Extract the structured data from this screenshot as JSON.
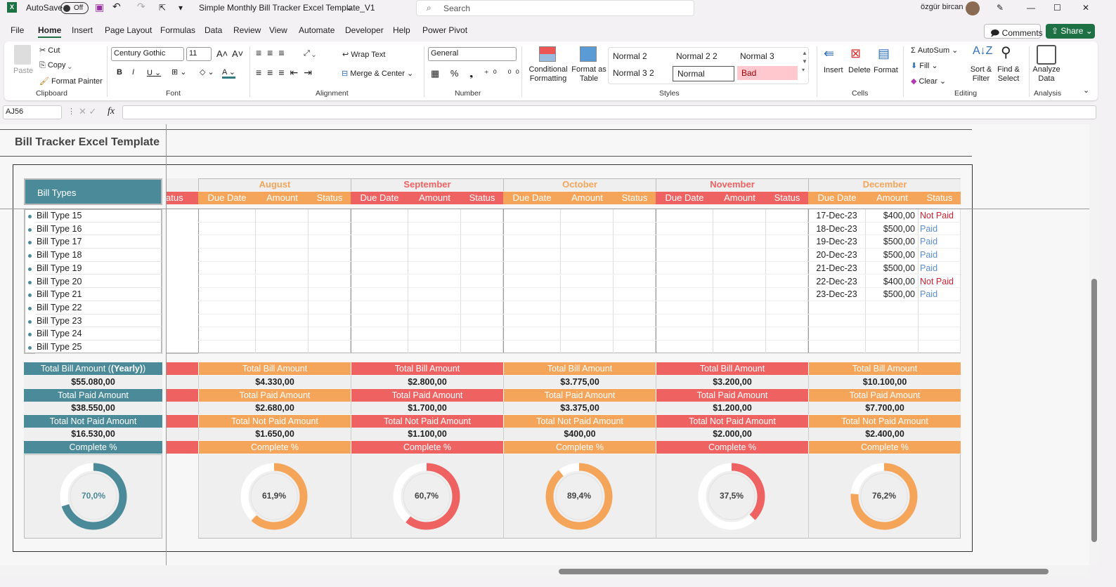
{
  "titlebar": {
    "app_icon": "excel-icon",
    "autosave_label": "AutoSave",
    "autosave_state": "Off",
    "filename": "Simple Monthly Bill Tracker Excel Template_V1",
    "search_placeholder": "Search",
    "user": "özgür bircan"
  },
  "menu": [
    "File",
    "Home",
    "Insert",
    "Page Layout",
    "Formulas",
    "Data",
    "Review",
    "View",
    "Automate",
    "Developer",
    "Help",
    "Power Pivot"
  ],
  "actions": {
    "comments": "Comments",
    "share": "Share"
  },
  "ribbon": {
    "clipboard": {
      "paste": "Paste",
      "cut": "Cut",
      "copy": "Copy",
      "format_painter": "Format Painter",
      "label": "Clipboard"
    },
    "font": {
      "name": "Century Gothic",
      "size": "11",
      "label": "Font"
    },
    "alignment": {
      "wrap": "Wrap Text",
      "merge": "Merge & Center",
      "label": "Alignment"
    },
    "number": {
      "format": "General",
      "label": "Number"
    },
    "styles": {
      "conditional": "Conditional Formatting",
      "format_table": "Format as Table",
      "cells": [
        "Normal 2",
        "Normal 2 2",
        "Normal 3",
        "Normal 3 2",
        "Normal",
        "Bad"
      ],
      "label": "Styles"
    },
    "cells": {
      "insert": "Insert",
      "delete": "Delete",
      "format": "Format",
      "label": "Cells"
    },
    "editing": {
      "autosum": "AutoSum",
      "fill": "Fill",
      "clear": "Clear",
      "sort": "Sort & Filter",
      "find": "Find & Select",
      "label": "Editing"
    },
    "analysis": {
      "analyze": "Analyze Data",
      "label": "Analysis"
    }
  },
  "formula_bar": {
    "name_box": "AJ56",
    "fx": "fx",
    "value": ""
  },
  "sheet": {
    "title": "Bill Tracker Excel Template",
    "bill_types_header": "Bill Types",
    "bill_types": [
      "Bill Type 15",
      "Bill Type 16",
      "Bill Type 17",
      "Bill Type 18",
      "Bill Type 19",
      "Bill Type 20",
      "Bill Type 21",
      "Bill Type 22",
      "Bill Type 23",
      "Bill Type 24",
      "Bill Type 25"
    ],
    "partial_col_header": "atus",
    "subheaders": [
      "Due Date",
      "Amount",
      "Status"
    ],
    "summary_labels": {
      "total_yearly": "Total Bill Amount",
      "yearly_suffix": "(Yearly)",
      "total": "Total Bill Amount",
      "paid": "Total Paid Amount",
      "not_paid": "Total Not Paid Amount",
      "complete": "Complete %"
    },
    "yearly": {
      "total": "$55.080,00",
      "paid": "$38.550,00",
      "not_paid": "$16.530,00",
      "complete_pct": 70.0,
      "complete_label": "70,0%"
    },
    "colors": {
      "teal": "#4a8a99",
      "orange": "#f4a55a",
      "red": "#ee6262",
      "paid": "#5b8fcf",
      "not_paid": "#cc1f2f"
    },
    "months": [
      {
        "name": "August",
        "color": "orange",
        "total": "$4.330,00",
        "paid": "$2.680,00",
        "not_paid": "$1.650,00",
        "complete_pct": 61.9,
        "complete_label": "61,9%",
        "rows": []
      },
      {
        "name": "September",
        "color": "red",
        "total": "$2.800,00",
        "paid": "$1.700,00",
        "not_paid": "$1.100,00",
        "complete_pct": 60.7,
        "complete_label": "60,7%",
        "rows": []
      },
      {
        "name": "October",
        "color": "orange",
        "total": "$3.775,00",
        "paid": "$3.375,00",
        "not_paid": "$400,00",
        "complete_pct": 89.4,
        "complete_label": "89,4%",
        "rows": []
      },
      {
        "name": "November",
        "color": "red",
        "total": "$3.200,00",
        "paid": "$1.200,00",
        "not_paid": "$2.000,00",
        "complete_pct": 37.5,
        "complete_label": "37,5%",
        "rows": []
      },
      {
        "name": "December",
        "color": "orange",
        "total": "$10.100,00",
        "paid": "$7.700,00",
        "not_paid": "$2.400,00",
        "complete_pct": 76.2,
        "complete_label": "76,2%",
        "rows": [
          [
            "17-Dec-23",
            "$400,00",
            "Not Paid"
          ],
          [
            "18-Dec-23",
            "$500,00",
            "Paid"
          ],
          [
            "19-Dec-23",
            "$500,00",
            "Paid"
          ],
          [
            "20-Dec-23",
            "$500,00",
            "Paid"
          ],
          [
            "21-Dec-23",
            "$500,00",
            "Paid"
          ],
          [
            "22-Dec-23",
            "$400,00",
            "Not Paid"
          ],
          [
            "23-Dec-23",
            "$500,00",
            "Paid"
          ]
        ]
      }
    ]
  }
}
